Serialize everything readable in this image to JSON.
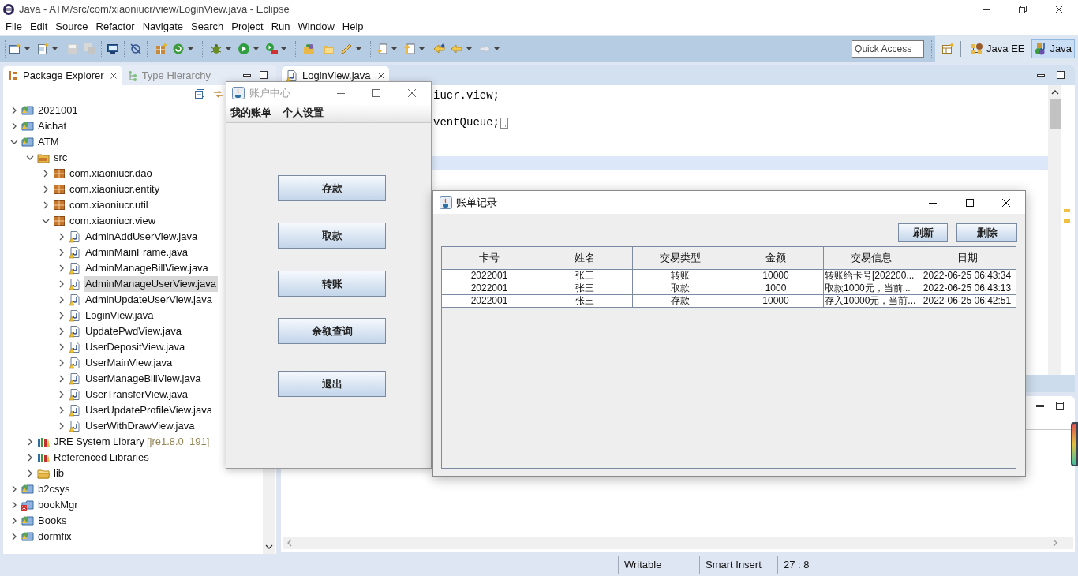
{
  "window": {
    "title": "Java - ATM/src/com/xiaoniucr/view/LoginView.java - Eclipse"
  },
  "menu": [
    "File",
    "Edit",
    "Source",
    "Refactor",
    "Navigate",
    "Search",
    "Project",
    "Run",
    "Window",
    "Help"
  ],
  "quick_access": {
    "placeholder": "Quick Access"
  },
  "perspectives": [
    {
      "label": "Java EE",
      "selected": false
    },
    {
      "label": "Java",
      "selected": true
    }
  ],
  "left_tabs": [
    {
      "label": "Package Explorer",
      "selected": true
    },
    {
      "label": "Type Hierarchy",
      "selected": false
    }
  ],
  "tree": [
    {
      "label": "2021001",
      "kind": "project",
      "expanded": false,
      "selected": false
    },
    {
      "label": "Aichat",
      "kind": "project",
      "expanded": false,
      "selected": false
    },
    {
      "label": "ATM",
      "kind": "project",
      "expanded": true,
      "selected": false,
      "children": [
        {
          "label": "src",
          "kind": "source-folder",
          "expanded": true,
          "selected": false,
          "children": [
            {
              "label": "com.xiaoniucr.dao",
              "kind": "package",
              "expanded": false,
              "selected": false
            },
            {
              "label": "com.xiaoniucr.entity",
              "kind": "package",
              "expanded": false,
              "selected": false
            },
            {
              "label": "com.xiaoniucr.util",
              "kind": "package",
              "expanded": false,
              "selected": false
            },
            {
              "label": "com.xiaoniucr.view",
              "kind": "package",
              "expanded": true,
              "selected": false,
              "children": [
                {
                  "label": "AdminAddUserView.java",
                  "kind": "java-file",
                  "expanded": false,
                  "selected": false
                },
                {
                  "label": "AdminMainFrame.java",
                  "kind": "java-file",
                  "expanded": false,
                  "selected": false
                },
                {
                  "label": "AdminManageBillView.java",
                  "kind": "java-file",
                  "expanded": false,
                  "selected": false
                },
                {
                  "label": "AdminManageUserView.java",
                  "kind": "java-file",
                  "expanded": false,
                  "selected": true
                },
                {
                  "label": "AdminUpdateUserView.java",
                  "kind": "java-file",
                  "expanded": false,
                  "selected": false
                },
                {
                  "label": "LoginView.java",
                  "kind": "java-file",
                  "expanded": false,
                  "selected": false
                },
                {
                  "label": "UpdatePwdView.java",
                  "kind": "java-file",
                  "expanded": false,
                  "selected": false
                },
                {
                  "label": "UserDepositView.java",
                  "kind": "java-file",
                  "expanded": false,
                  "selected": false
                },
                {
                  "label": "UserMainView.java",
                  "kind": "java-file",
                  "expanded": false,
                  "selected": false
                },
                {
                  "label": "UserManageBillView.java",
                  "kind": "java-file",
                  "expanded": false,
                  "selected": false
                },
                {
                  "label": "UserTransferView.java",
                  "kind": "java-file",
                  "expanded": false,
                  "selected": false
                },
                {
                  "label": "UserUpdateProfileView.java",
                  "kind": "java-file",
                  "expanded": false,
                  "selected": false
                },
                {
                  "label": "UserWithDrawView.java",
                  "kind": "java-file",
                  "expanded": false,
                  "selected": false
                }
              ]
            }
          ]
        },
        {
          "label": "JRE System Library",
          "decoration": "[jre1.8.0_191]",
          "kind": "library",
          "expanded": false,
          "selected": false
        },
        {
          "label": "Referenced Libraries",
          "kind": "library",
          "expanded": false,
          "selected": false
        },
        {
          "label": "lib",
          "kind": "folder",
          "expanded": false,
          "selected": false
        }
      ]
    },
    {
      "label": "b2csys",
      "kind": "project",
      "expanded": false,
      "selected": false
    },
    {
      "label": "bookMgr",
      "kind": "project-error",
      "expanded": false,
      "selected": false
    },
    {
      "label": "Books",
      "kind": "project",
      "expanded": false,
      "selected": false
    },
    {
      "label": "dormfix",
      "kind": "project",
      "expanded": false,
      "selected": false
    }
  ],
  "editor": {
    "tab": "LoginView.java",
    "lines": [
      {
        "text": "iucr.view;",
        "folded": false,
        "current": false
      },
      {
        "folded": false,
        "current": false
      },
      {
        "text": "ventQueue;",
        "folded": true,
        "current": false
      },
      {
        "folded": false,
        "current": false
      },
      {
        "folded": false,
        "current": false
      },
      {
        "folded": false,
        "current": true
      }
    ]
  },
  "status_bar": [
    "Writable",
    "Smart Insert",
    "27 : 8"
  ],
  "account_window": {
    "title": "账户中心",
    "active": false,
    "menus": [
      "我的账单",
      "个人设置"
    ],
    "buttons": [
      "存款",
      "取款",
      "转账",
      "余额查询",
      "退出"
    ]
  },
  "bill_window": {
    "title": "账单记录",
    "active": true,
    "buttons": [
      "刷新",
      "删除"
    ],
    "table": {
      "columns": [
        "卡号",
        "姓名",
        "交易类型",
        "金额",
        "交易信息",
        "日期"
      ],
      "rows": [
        [
          "2022001",
          "张三",
          "转账",
          "10000",
          "转账给卡号[202200...",
          "2022-06-25 06:43:34"
        ],
        [
          "2022001",
          "张三",
          "取款",
          "1000",
          "取款1000元，当前...",
          "2022-06-25 06:43:13"
        ],
        [
          "2022001",
          "张三",
          "存款",
          "10000",
          "存入10000元，当前...",
          "2022-06-25 06:42:51"
        ]
      ]
    }
  }
}
